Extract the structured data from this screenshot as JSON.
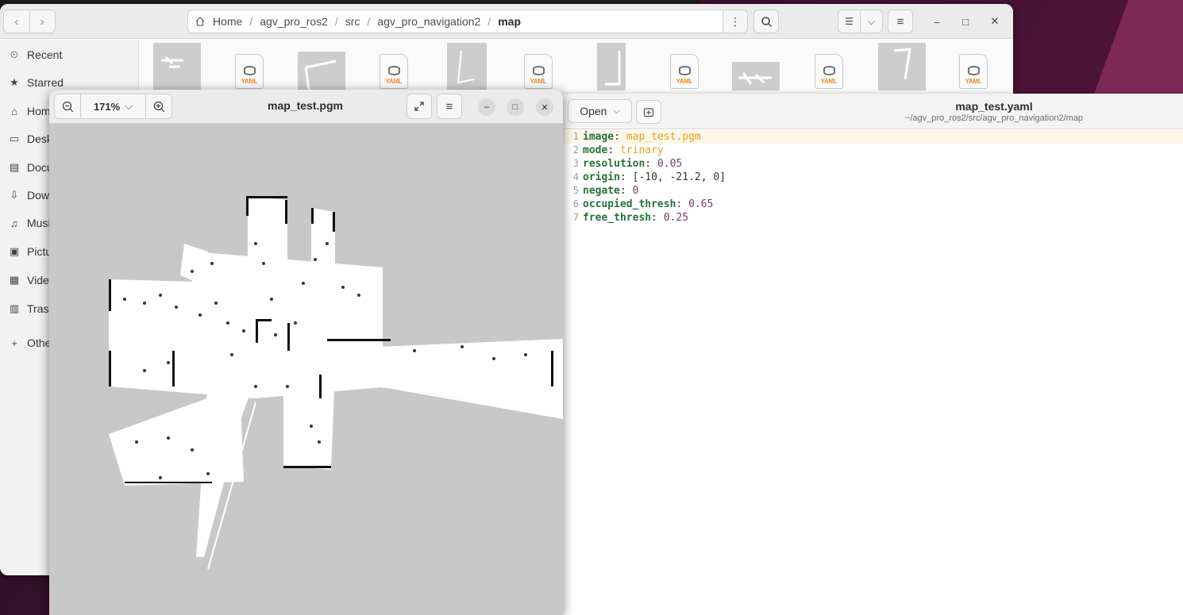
{
  "file_manager": {
    "path": [
      "Home",
      "agv_pro_ros2",
      "src",
      "agv_pro_navigation2",
      "map"
    ],
    "sidebar": [
      {
        "label": "Recent",
        "icon": "clock-icon"
      },
      {
        "label": "Starred",
        "icon": "star-icon"
      },
      {
        "label": "Hom",
        "icon": "home-icon"
      },
      {
        "label": "Desk",
        "icon": "desktop-icon"
      },
      {
        "label": "Docu",
        "icon": "document-icon"
      },
      {
        "label": "Dow",
        "icon": "download-icon"
      },
      {
        "label": "Musi",
        "icon": "music-icon"
      },
      {
        "label": "Pictu",
        "icon": "picture-icon"
      },
      {
        "label": "Vide",
        "icon": "video-icon"
      },
      {
        "label": "Trasl",
        "icon": "trash-icon"
      },
      {
        "label": "Othe",
        "icon": "plus-icon"
      }
    ],
    "yaml_badge": "YAML"
  },
  "image_viewer": {
    "title": "map_test.pgm",
    "zoom": "171%"
  },
  "text_editor": {
    "open_label": "Open",
    "title": "map_test.yaml",
    "subtitle": "~/agv_pro_ros2/src/agv_pro_navigation2/map",
    "lines": [
      {
        "n": "1",
        "key": "image",
        "value": "map_test.pgm",
        "type": "string"
      },
      {
        "n": "2",
        "key": "mode",
        "value": "trinary",
        "type": "string"
      },
      {
        "n": "3",
        "key": "resolution",
        "value": "0.05",
        "type": "number"
      },
      {
        "n": "4",
        "key": "origin",
        "value": "[-10, -21.2, 0]",
        "type": "list"
      },
      {
        "n": "5",
        "key": "negate",
        "value": "0",
        "type": "number"
      },
      {
        "n": "6",
        "key": "occupied_thresh",
        "value": "0.65",
        "type": "number"
      },
      {
        "n": "7",
        "key": "free_thresh",
        "value": "0.25",
        "type": "number"
      }
    ]
  },
  "colors": {
    "yaml_key": "#26703a",
    "yaml_string": "#e5a01f",
    "yaml_number": "#7a3a6b",
    "desktop_accent": "#7c2a55"
  }
}
